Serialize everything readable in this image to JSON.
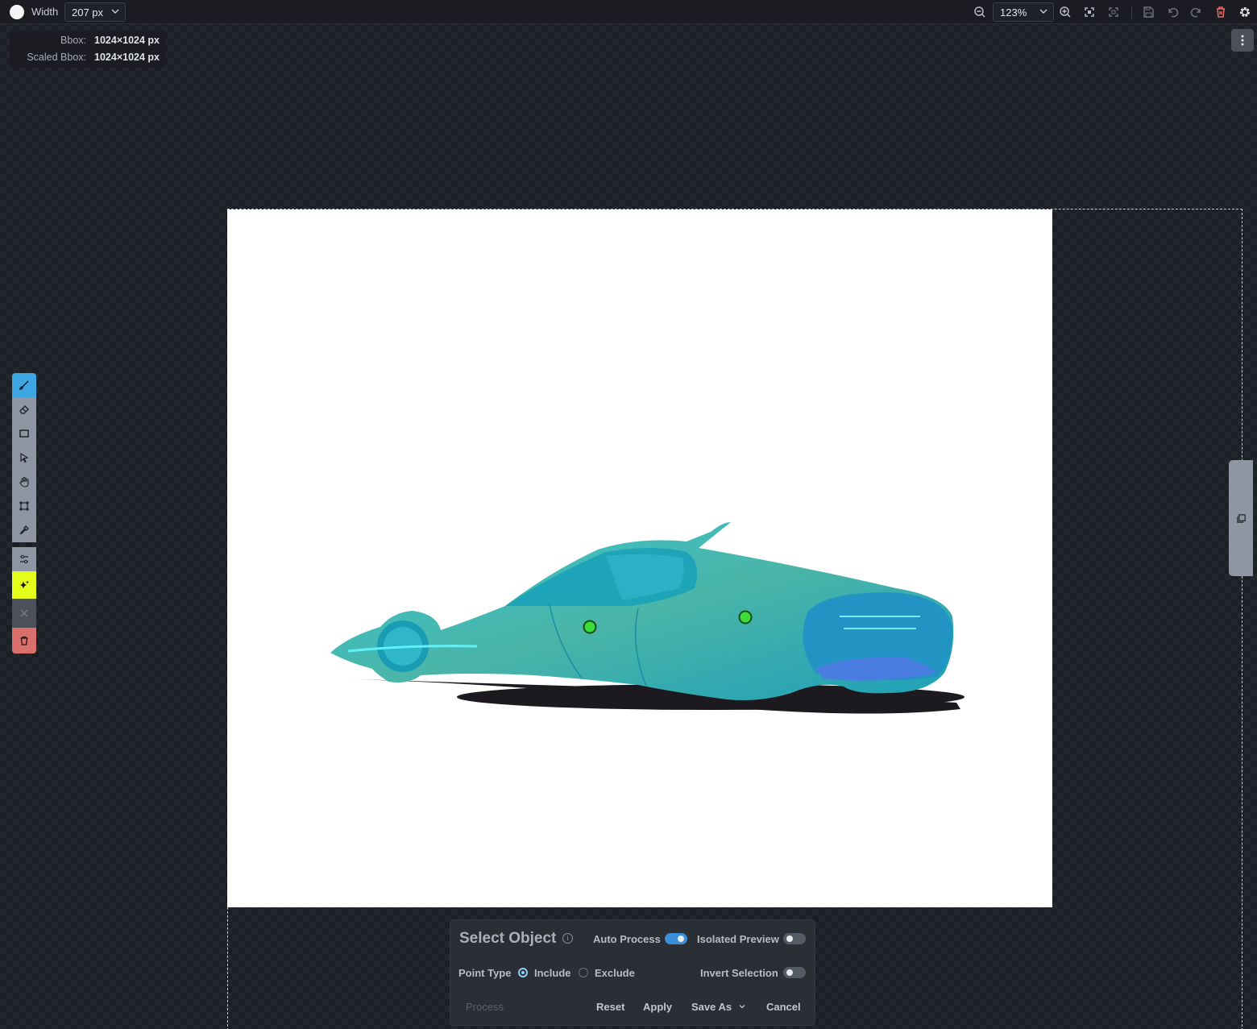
{
  "toolbar": {
    "width_label": "Width",
    "width_value": "207 px",
    "zoom_value": "123%",
    "icons": [
      "zoom-out-icon",
      "zoom-in-icon",
      "fit-icon",
      "reset-view-icon",
      "save-icon",
      "undo-icon",
      "redo-icon",
      "trash-icon",
      "gear-icon"
    ]
  },
  "bbox": {
    "bbox_label": "Bbox:",
    "bbox_value": "1024×1024 px",
    "scaled_label": "Scaled Bbox:",
    "scaled_value": "1024×1024 px"
  },
  "tools": [
    "brush-icon",
    "eraser-icon",
    "rectangle-icon",
    "select-arrow-icon",
    "hand-icon",
    "transform-icon",
    "eyedropper-icon",
    "sliders-icon",
    "sparkle-icon",
    "close-icon",
    "trash-icon"
  ],
  "panel": {
    "title": "Select Object",
    "auto_process_label": "Auto Process",
    "auto_process_on": true,
    "isolated_preview_label": "Isolated Preview",
    "isolated_preview_on": false,
    "point_type_label": "Point Type",
    "include_label": "Include",
    "exclude_label": "Exclude",
    "selected_point_type": "Include",
    "invert_selection_label": "Invert Selection",
    "invert_selection_on": false,
    "process_label": "Process",
    "reset_label": "Reset",
    "apply_label": "Apply",
    "save_as_label": "Save As",
    "cancel_label": "Cancel"
  },
  "colors": {
    "accent": "#3ea6e0",
    "ai_tool": "#e6ff1a",
    "delete_tool": "#d9706c",
    "mask_overlay": "#2ab8c8",
    "point_marker": "#3ddc3d"
  }
}
